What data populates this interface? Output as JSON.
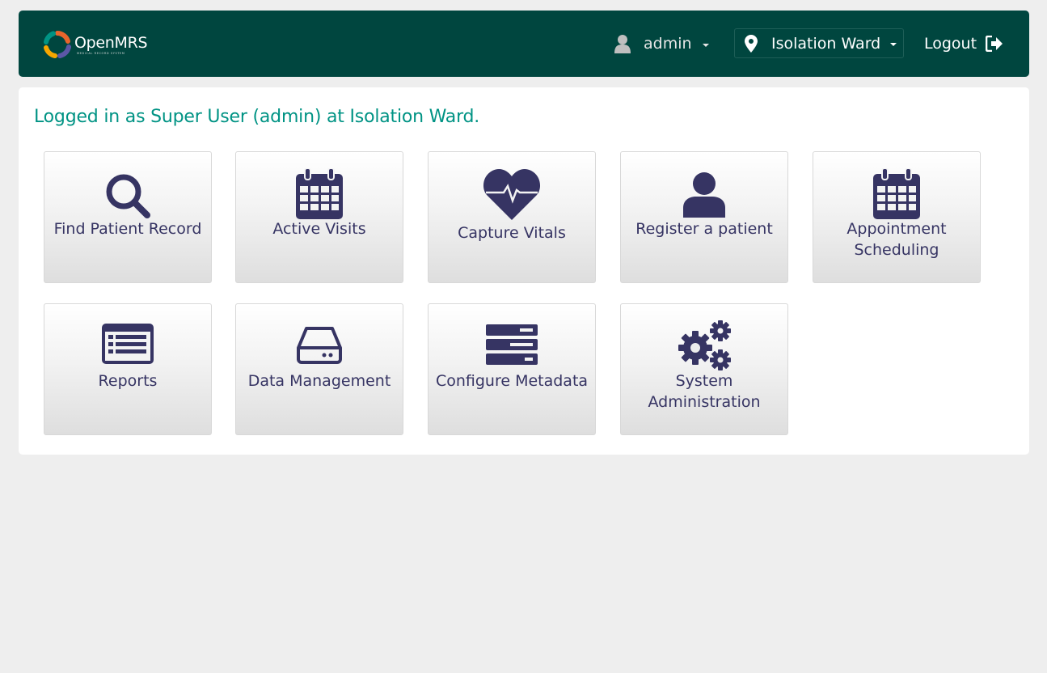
{
  "header": {
    "logo_name": "OpenMRS",
    "logo_tagline": "MEDICAL RECORD SYSTEM",
    "user_name": "admin",
    "location": "Isolation Ward",
    "logout_label": "Logout"
  },
  "main": {
    "welcome": "Logged in as Super User (admin) at Isolation Ward.",
    "apps": [
      {
        "label": "Find Patient Record",
        "icon": "search-icon"
      },
      {
        "label": "Active Visits",
        "icon": "calendar-icon"
      },
      {
        "label": "Capture Vitals",
        "icon": "heartbeat-icon"
      },
      {
        "label": "Register a patient",
        "icon": "user-icon"
      },
      {
        "label": "Appointment Scheduling",
        "icon": "calendar-icon"
      },
      {
        "label": "Reports",
        "icon": "list-alt-icon"
      },
      {
        "label": "Data Management",
        "icon": "hdd-icon"
      },
      {
        "label": "Configure Metadata",
        "icon": "tasks-icon"
      },
      {
        "label": "System Administration",
        "icon": "cogs-icon"
      }
    ]
  },
  "colors": {
    "header_bg": "#00463f",
    "page_bg": "#eeeeee",
    "welcome_text": "#009384",
    "tile_text": "#363463",
    "icon_color": "#363463"
  }
}
